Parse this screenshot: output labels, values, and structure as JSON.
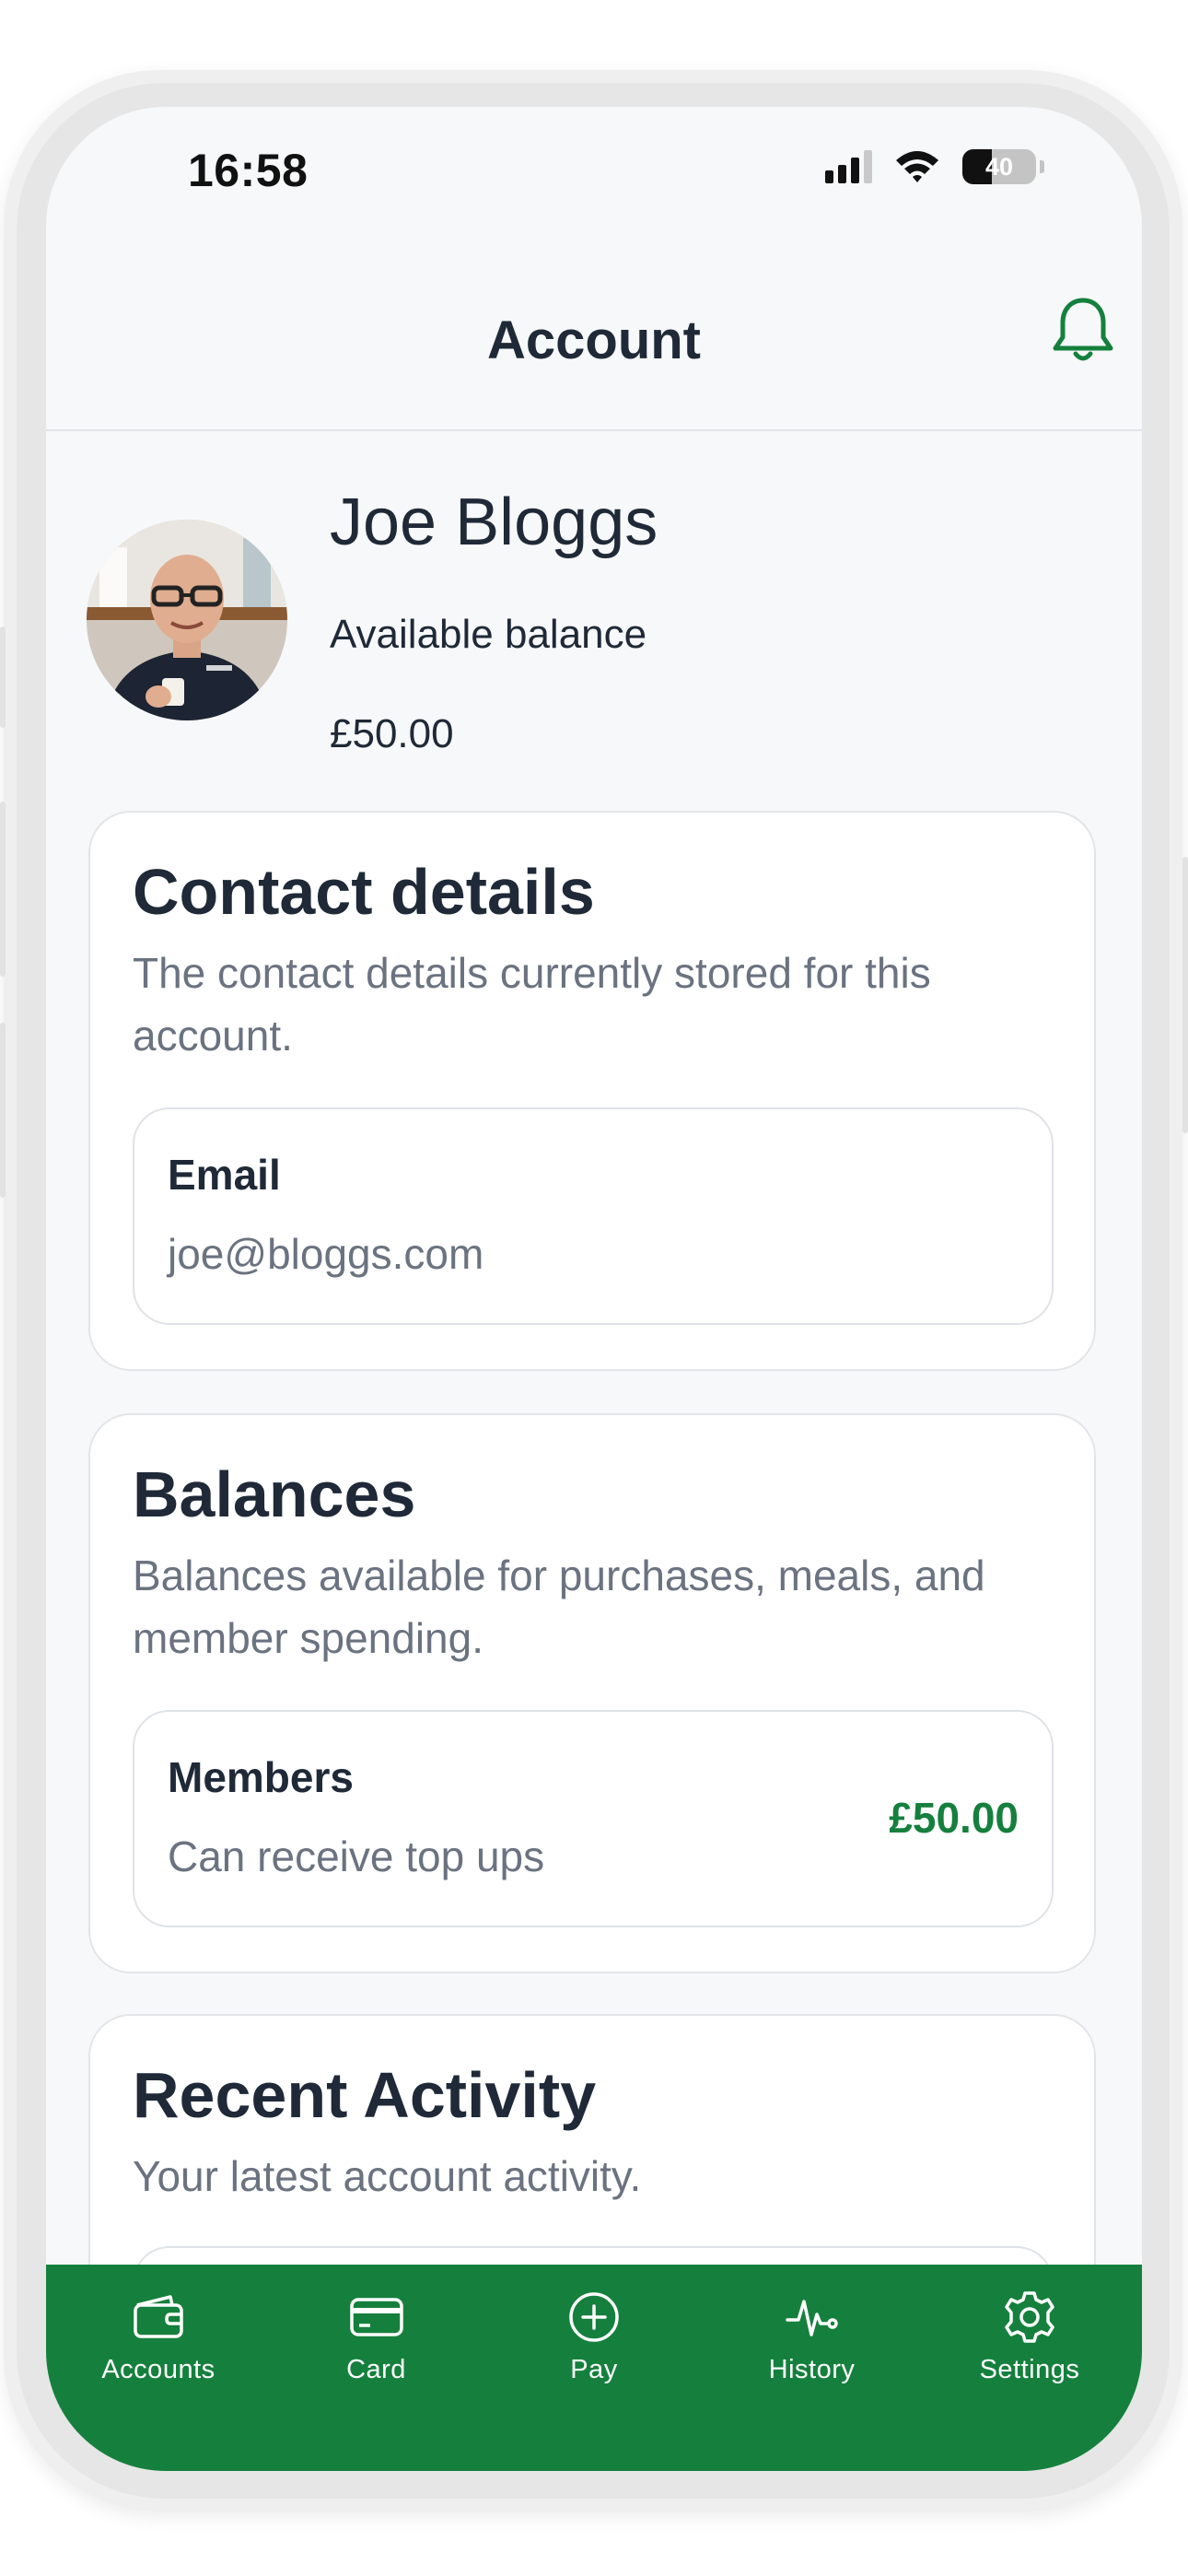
{
  "status_bar": {
    "time": "16:58",
    "battery_level": "40",
    "battery_fraction": 0.4
  },
  "header": {
    "title": "Account",
    "bell_icon": "bell-icon"
  },
  "profile": {
    "name": "Joe Bloggs",
    "balance_label": "Available balance",
    "balance": "£50.00"
  },
  "contact": {
    "title": "Contact details",
    "description": "The contact details currently stored for this account.",
    "email_label": "Email",
    "email_value": "joe@bloggs.com"
  },
  "balances": {
    "title": "Balances",
    "description": "Balances available for purchases, meals, and member spending.",
    "items": [
      {
        "label": "Members",
        "subtitle": "Can receive top ups",
        "amount": "£50.00"
      }
    ]
  },
  "activity": {
    "title": "Recent Activity",
    "description": "Your latest account activity."
  },
  "tabbar": {
    "tabs": [
      {
        "label": "Accounts",
        "icon": "wallet-icon"
      },
      {
        "label": "Card",
        "icon": "card-icon"
      },
      {
        "label": "Pay",
        "icon": "plus-circle-icon"
      },
      {
        "label": "History",
        "icon": "activity-icon"
      },
      {
        "label": "Settings",
        "icon": "gear-icon"
      }
    ]
  },
  "colors": {
    "accent": "#15803d",
    "heading": "#1f2937",
    "muted": "#6b7280",
    "background": "#f7f8f9"
  }
}
